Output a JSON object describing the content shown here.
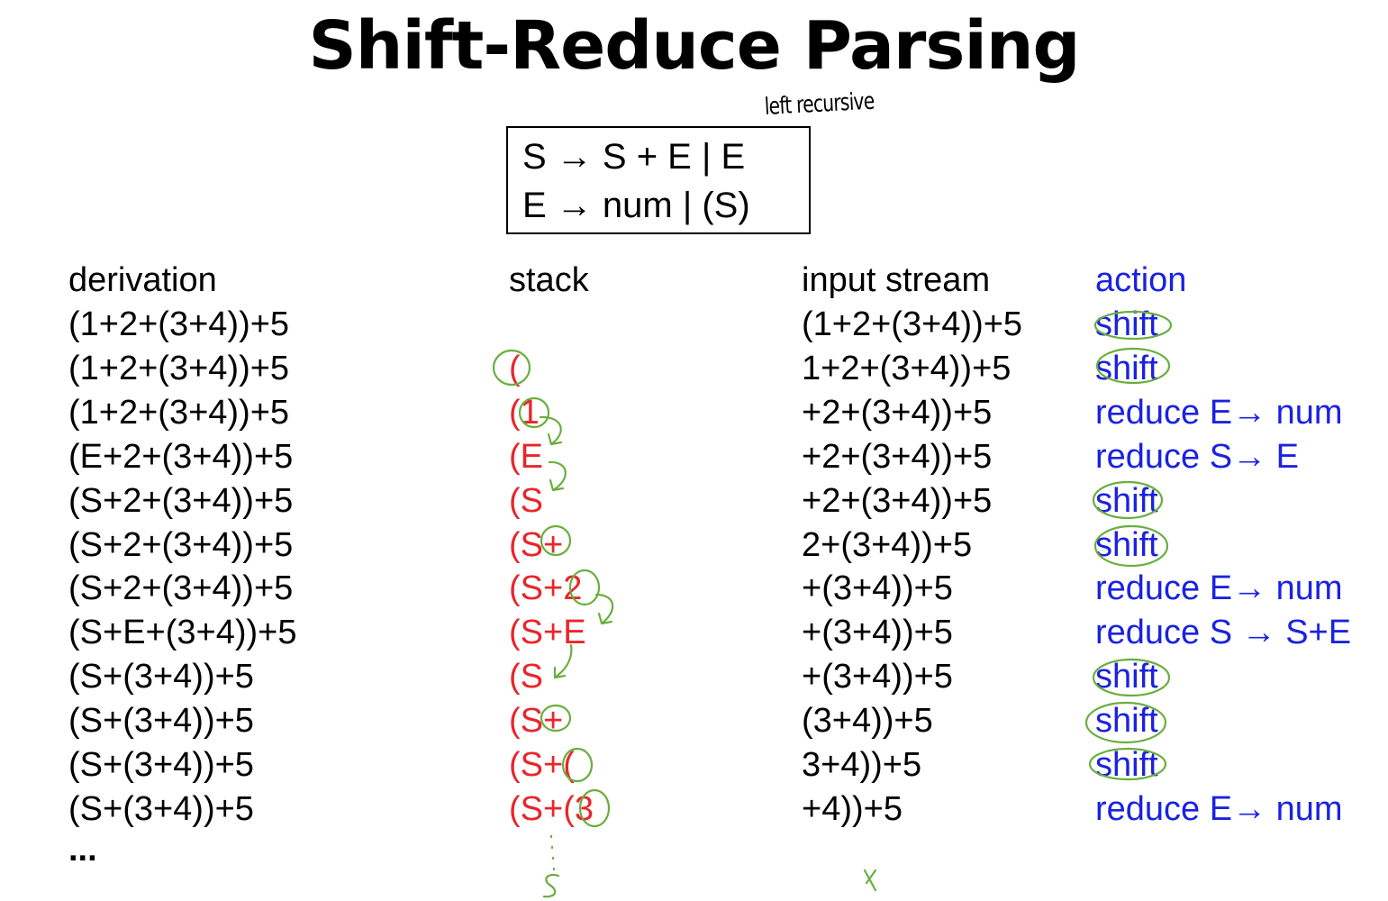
{
  "title": "Shift-Reduce Parsing",
  "handwritten_note": "left recursive",
  "grammar": {
    "line1": "S → S + E | E",
    "line2": "E → num | (S)"
  },
  "headers": {
    "derivation": "derivation",
    "stack": "stack",
    "input": "input stream",
    "action": "action"
  },
  "rows": [
    {
      "derivation": "(1+2+(3+4))+5",
      "stack": "",
      "input": "(1+2+(3+4))+5",
      "action": "shift"
    },
    {
      "derivation": "(1+2+(3+4))+5",
      "stack": "(",
      "input": "1+2+(3+4))+5",
      "action": "shift"
    },
    {
      "derivation": "(1+2+(3+4))+5",
      "stack": "(1",
      "input": "+2+(3+4))+5",
      "action": "reduce E→ num"
    },
    {
      "derivation": "(E+2+(3+4))+5",
      "stack": "(E",
      "input": "+2+(3+4))+5",
      "action": "reduce S→ E"
    },
    {
      "derivation": "(S+2+(3+4))+5",
      "stack": "(S",
      "input": "+2+(3+4))+5",
      "action": "shift"
    },
    {
      "derivation": "(S+2+(3+4))+5",
      "stack": "(S+",
      "input": "2+(3+4))+5",
      "action": "shift"
    },
    {
      "derivation": "(S+2+(3+4))+5",
      "stack": "(S+2",
      "input": "+(3+4))+5",
      "action": "reduce E→ num"
    },
    {
      "derivation": "(S+E+(3+4))+5",
      "stack": "(S+E",
      "input": "+(3+4))+5",
      "action": "reduce S → S+E"
    },
    {
      "derivation": "(S+(3+4))+5",
      "stack": "(S",
      "input": "+(3+4))+5",
      "action": "shift"
    },
    {
      "derivation": "(S+(3+4))+5",
      "stack": "(S+",
      "input": "(3+4))+5",
      "action": "shift"
    },
    {
      "derivation": "(S+(3+4))+5",
      "stack": "(S+(",
      "input": "3+4))+5",
      "action": "shift"
    },
    {
      "derivation": "(S+(3+4))+5",
      "stack": "(S+(3",
      "input": "+4))+5",
      "action": "reduce E→ num"
    }
  ],
  "ellipsis": "...",
  "colors": {
    "stack": "#e8262a",
    "action": "#1a22e0",
    "annotation": "#6aae3e"
  }
}
